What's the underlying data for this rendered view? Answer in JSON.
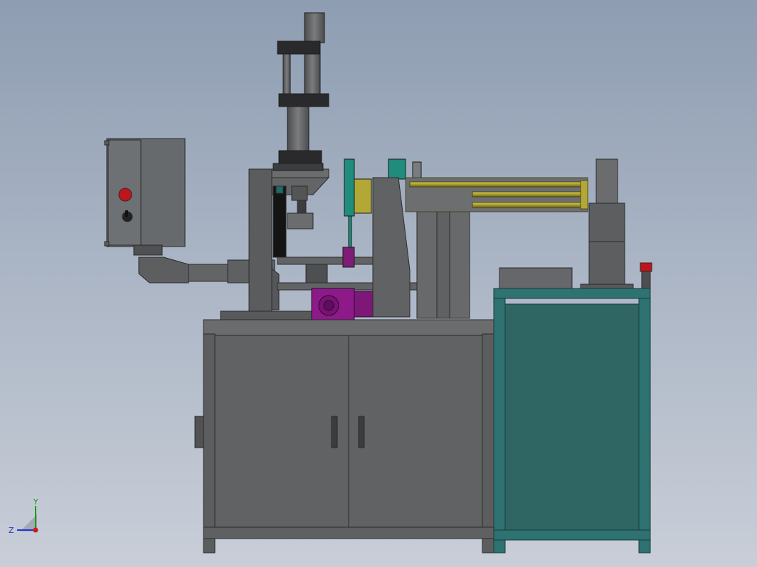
{
  "triad": {
    "y_label": "Y",
    "z_label": "Z"
  },
  "colors": {
    "steel": "#5f6163",
    "steel_dark": "#3e4042",
    "cabinet": "#606264",
    "teal_frame": "#2e7272",
    "teal_panel": "#2f6663",
    "purple_motor": "#8e1a8a",
    "yellow_rod": "#b3a836",
    "green_bracket": "#1f8c7c",
    "red_button": "#c0141c"
  }
}
